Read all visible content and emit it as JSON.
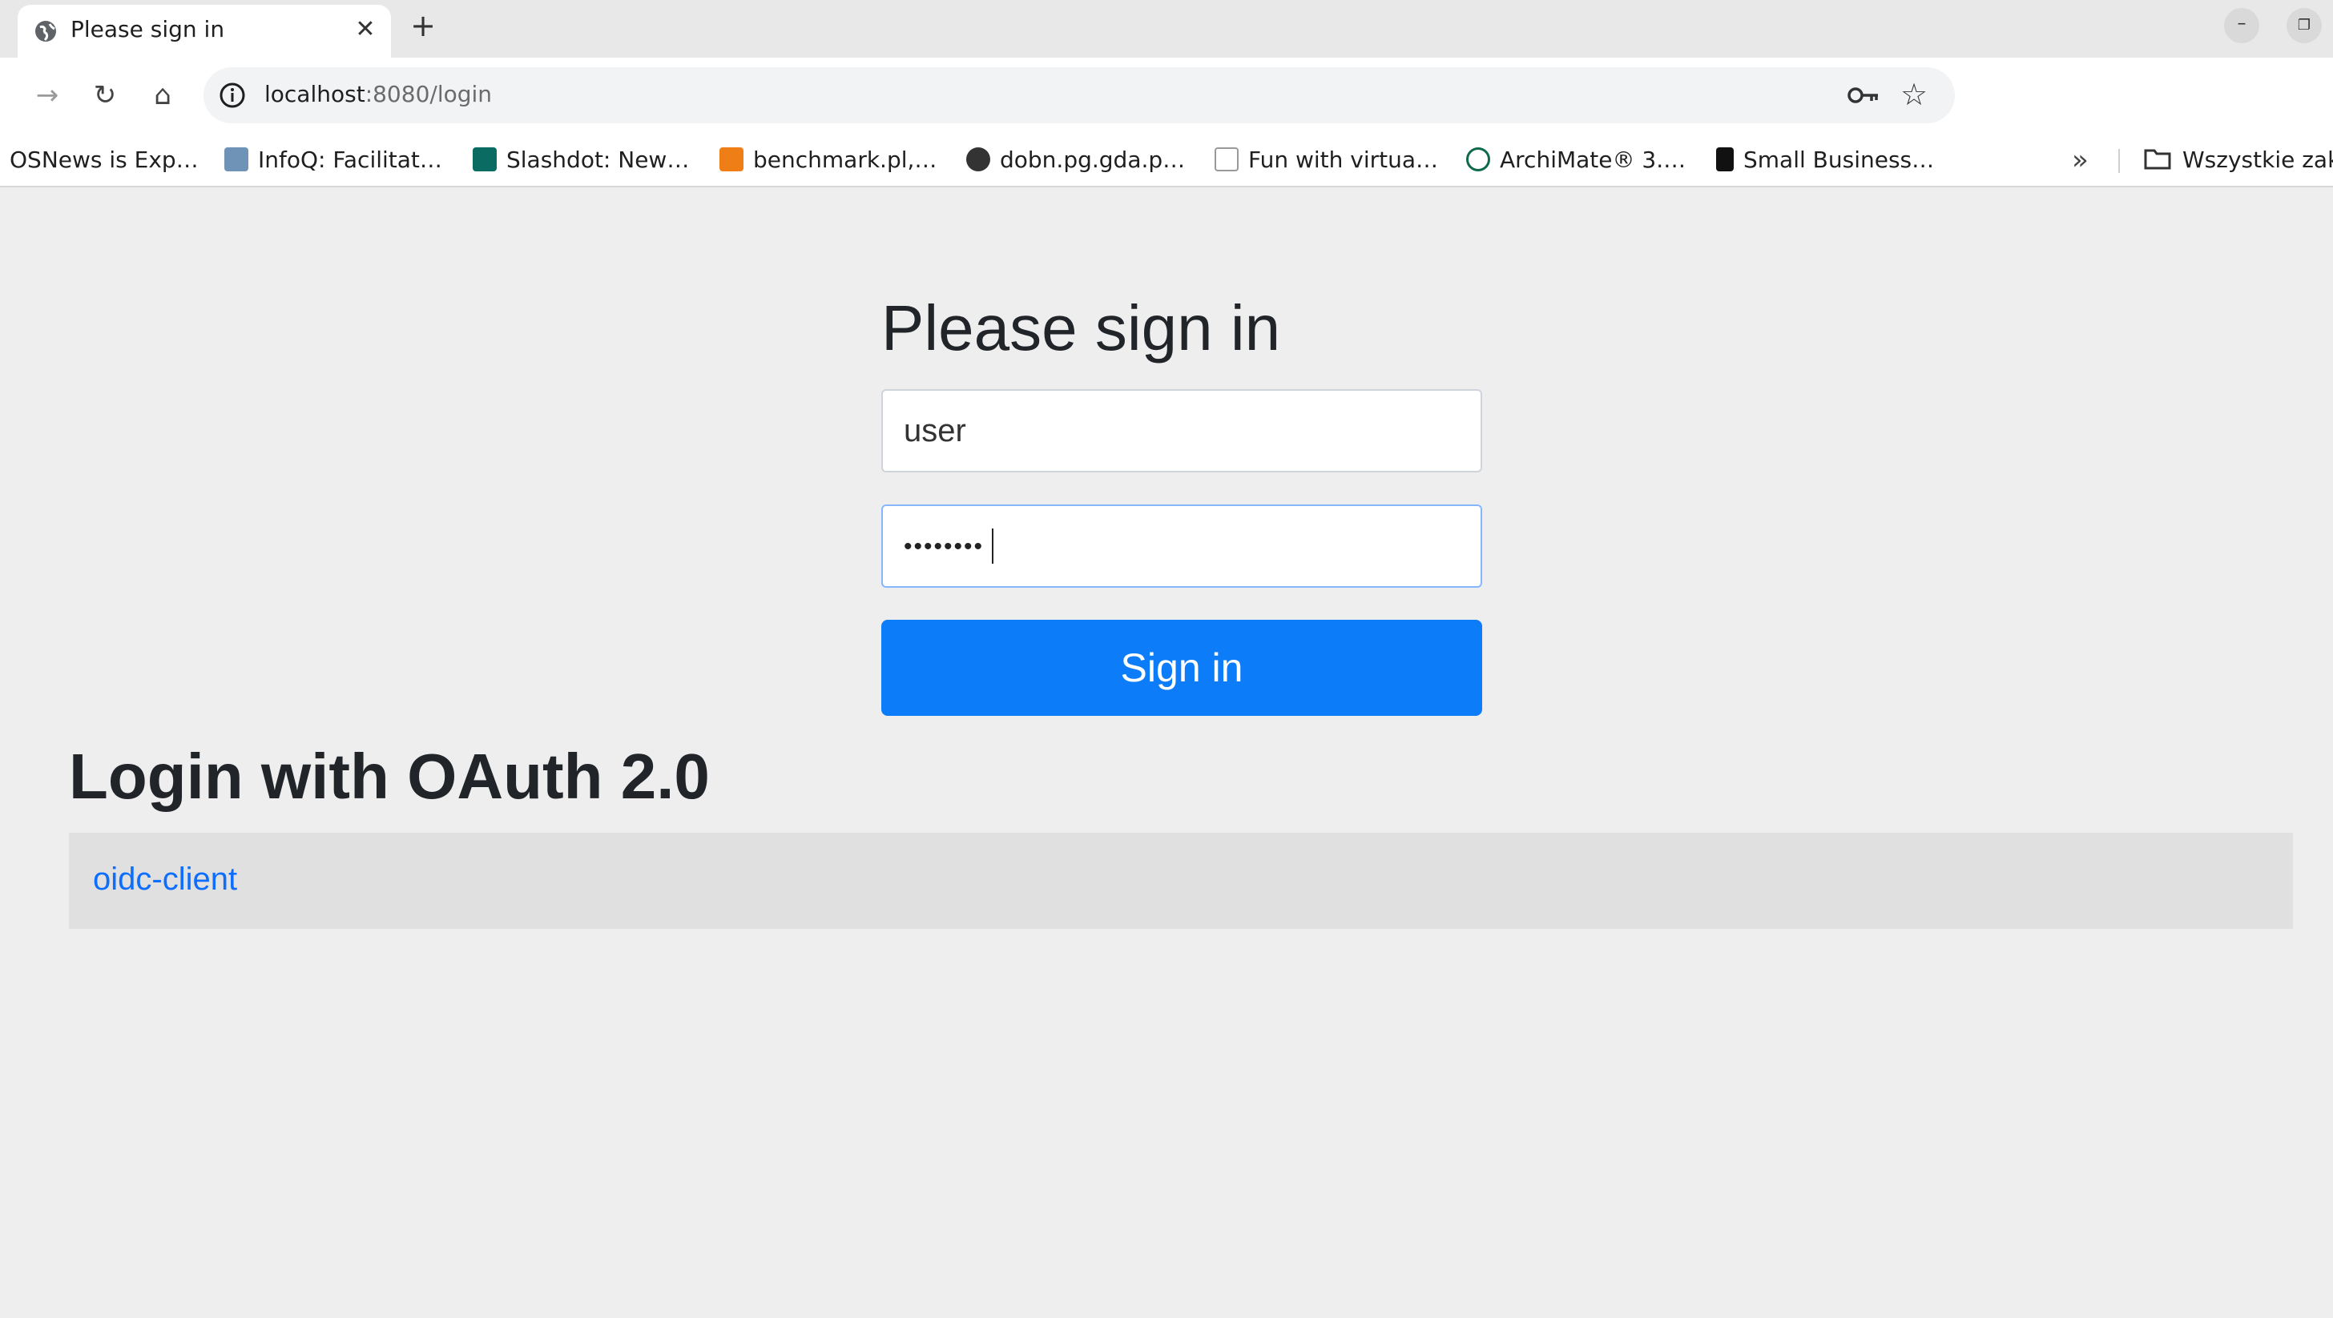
{
  "browser": {
    "tab": {
      "title": "Please sign in",
      "favicon": "globe-icon",
      "close_glyph": "✕"
    },
    "new_tab_glyph": "+",
    "window": {
      "minimize_glyph": "–",
      "restore_glyph": "❐"
    },
    "nav": {
      "back_glyph": "→",
      "reload_glyph": "↻",
      "home_glyph": "⌂"
    },
    "url": {
      "host": "localhost",
      "rest": ":8080/login"
    },
    "star_glyph": "☆",
    "bookmarks": [
      {
        "label": "OSNews is Exp…",
        "icon": "none"
      },
      {
        "label": "InfoQ: Facilitat…",
        "icon": "infoq-icon"
      },
      {
        "label": "Slashdot: New…",
        "icon": "slashdot-icon"
      },
      {
        "label": "benchmark.pl,…",
        "icon": "benchmark-icon"
      },
      {
        "label": "dobn.pg.gda.p…",
        "icon": "globe-icon"
      },
      {
        "label": "Fun with virtua…",
        "icon": "vf-icon"
      },
      {
        "label": "ArchiMate® 3.…",
        "icon": "archimate-icon"
      },
      {
        "label": "Small Business…",
        "icon": "i-icon"
      }
    ],
    "bookmarks_more_glyph": "»",
    "all_bookmarks_label": "Wszystkie zak"
  },
  "page": {
    "title": "Please sign in",
    "username_value": "user",
    "password_dots": "••••••••",
    "submit_label": "Sign in",
    "oauth_heading": "Login with OAuth 2.0",
    "oauth_client": "oidc-client"
  },
  "colors": {
    "primary": "#0d7cf8",
    "link": "#0d6efd",
    "page_bg": "#eeeeee",
    "table_bg": "#e0e0e0"
  }
}
